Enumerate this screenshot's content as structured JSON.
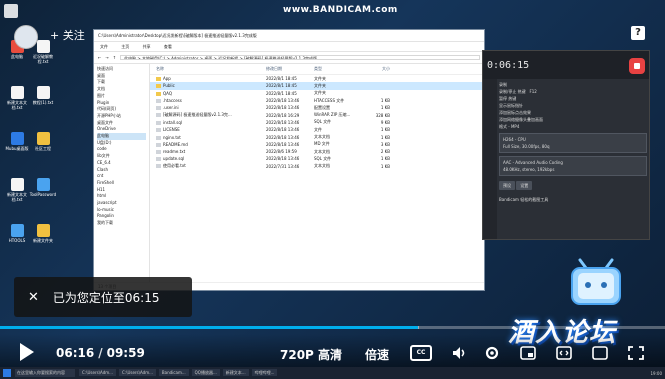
{
  "watermark": "www.BANDICAM.com",
  "follow_label": "+ 关注",
  "help_label": "?",
  "desktop_icons": [
    {
      "label": "此电脑"
    },
    {
      "label": "近况破解教程.txt"
    },
    {
      "label": "新建文本文档.txt"
    },
    {
      "label": "教程(1).txt"
    },
    {
      "label": "Mubu桌面版"
    },
    {
      "label": "社区工程"
    },
    {
      "label": "新建文本文档.txt"
    },
    {
      "label": "ToolPassword"
    },
    {
      "label": "HTOOLS"
    },
    {
      "label": "新建文件夹"
    }
  ],
  "explorer": {
    "title": "C:\\Users\\Administrator\\Desktop\\近况发新程\\[破解版本] 极速推送轻量版v2.1.3完成版",
    "menu": [
      "文件",
      "主页",
      "共享",
      "查看"
    ],
    "address": "此电脑 > 本地磁盘(C:) > Administrator > 桌面 > 近况发新程 > [破解源码] 极速推送轻量版v2.1.3完成版",
    "nav": [
      "快速访问",
      "桌面",
      "下载",
      "文档",
      "图片",
      "Plugin",
      "代码(网页)",
      "开源PHP小站",
      "桌面文件",
      "OneDrive",
      "此电脑",
      "U盘(D:)",
      "code",
      "lib文件",
      "CE_6.4",
      "Clash",
      "cnt",
      "FireShell",
      "H11",
      "html",
      "javascript",
      "lo-music",
      "Pangolin",
      "我的下载"
    ],
    "nav_selected": 10,
    "headers": {
      "name": "名称",
      "date": "修改日期",
      "type": "类型",
      "size": "大小"
    },
    "files": [
      {
        "name": "App",
        "date": "2022/8/1 18:45",
        "type": "文件夹",
        "size": "",
        "kind": "folder",
        "selected": false
      },
      {
        "name": "Public",
        "date": "2022/8/1 18:45",
        "type": "文件夹",
        "size": "",
        "kind": "folder",
        "selected": true
      },
      {
        "name": "QAQ",
        "date": "2022/8/1 18:45",
        "type": "文件夹",
        "size": "",
        "kind": "folder",
        "selected": false
      },
      {
        "name": ".htaccess",
        "date": "2022/8/18 13:46",
        "type": "HTACCESS 文件",
        "size": "1 KB",
        "kind": "file",
        "selected": false
      },
      {
        "name": ".user.ini",
        "date": "2022/8/18 13:46",
        "type": "配置设置",
        "size": "1 KB",
        "kind": "file",
        "selected": false
      },
      {
        "name": "[破解源码] 极速推送轻量版v2.1.3完...",
        "date": "2022/8/18 16:29",
        "type": "WinRAR ZIP 压缩...",
        "size": "328 KB",
        "kind": "file",
        "selected": false
      },
      {
        "name": "install.sql",
        "date": "2022/8/18 13:46",
        "type": "SQL 文件",
        "size": "9 KB",
        "kind": "file",
        "selected": false
      },
      {
        "name": "LICENSE",
        "date": "2022/8/18 13:46",
        "type": "文件",
        "size": "1 KB",
        "kind": "file",
        "selected": false
      },
      {
        "name": "nginx.txt",
        "date": "2022/8/18 13:46",
        "type": "文本文档",
        "size": "1 KB",
        "kind": "file",
        "selected": false
      },
      {
        "name": "README.md",
        "date": "2022/8/18 13:46",
        "type": "MD 文件",
        "size": "3 KB",
        "kind": "file",
        "selected": false
      },
      {
        "name": "readme.txt",
        "date": "2022/8/6 19:59",
        "type": "文本文档",
        "size": "2 KB",
        "kind": "file",
        "selected": false
      },
      {
        "name": "update.sql",
        "date": "2022/8/18 13:46",
        "type": "SQL 文件",
        "size": "1 KB",
        "kind": "file",
        "selected": false
      },
      {
        "name": "使用必看.txt",
        "date": "2022/7/31 13:46",
        "type": "文本文档",
        "size": "1 KB",
        "kind": "file",
        "selected": false
      }
    ],
    "status": "13 个项目"
  },
  "bandicam": {
    "timer": "0:06:15",
    "rows": [
      "录制",
      "录制/停止 热键",
      "暂停 热键",
      "显示鼠标指针",
      "添加鼠标点击效果",
      "添加网络摄像头叠加画面",
      "格式 - MP4"
    ],
    "hotkey": "F12",
    "video_box": [
      "H264 - CPU",
      "Full Size, 30.00fps, 80q"
    ],
    "audio_box": [
      "AAC - Advanced Audio Coding",
      "48.0KHz, stereo, 192kbps"
    ],
    "buttons": [
      "预设",
      "设置"
    ],
    "footer": "Bandicam 轻松的截图工具"
  },
  "taskbar": {
    "search_placeholder": "在这里输入你要搜索的内容",
    "items": [
      "C:\\Users\\Adm...",
      "C:\\Users\\Adm...",
      "Bandicam...",
      "QQ播放器...",
      "新建文本...",
      "哔哩哔哩..."
    ],
    "clock": "19:00"
  },
  "brand_text": "酒入论坛",
  "toast": {
    "close_label": "✕",
    "message": "已为您定位至06:15"
  },
  "player": {
    "current_time": "06:16",
    "separator": "/",
    "duration": "09:59",
    "quality": "720P 高清",
    "speed": "倍速",
    "subtitle_label": "CC",
    "progress": {
      "played": 0.628,
      "buffered": 0.63
    }
  },
  "colors": {
    "accent": "#00aeec",
    "brand_glow": "#2e8cff"
  }
}
